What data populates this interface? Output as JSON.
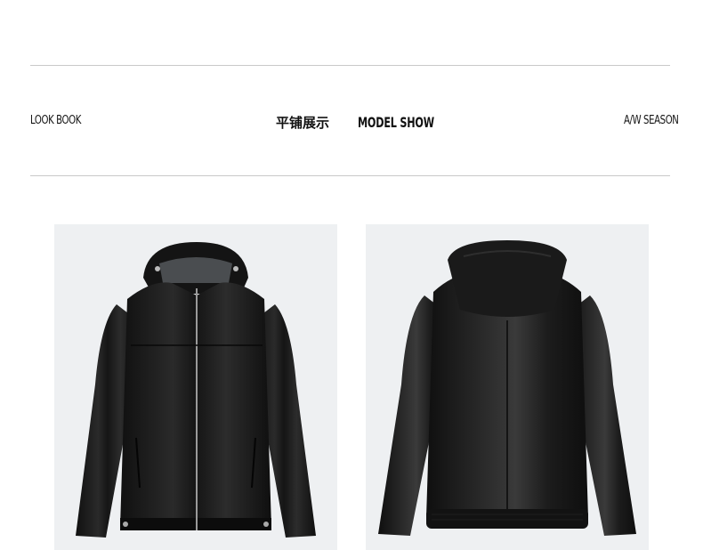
{
  "header": {
    "left_label": "LOOK BOOK",
    "center_cn": "平铺展示",
    "center_en": "MODEL SHOW",
    "right_label": "A/W SEASON"
  },
  "images": [
    {
      "icon": "jacket-front-icon"
    },
    {
      "icon": "jacket-back-icon"
    }
  ],
  "colors": {
    "background": "#ffffff",
    "rule": "#c9c9c9",
    "photo_bg": "#eef0f2",
    "leather": "#1a1a1a"
  }
}
